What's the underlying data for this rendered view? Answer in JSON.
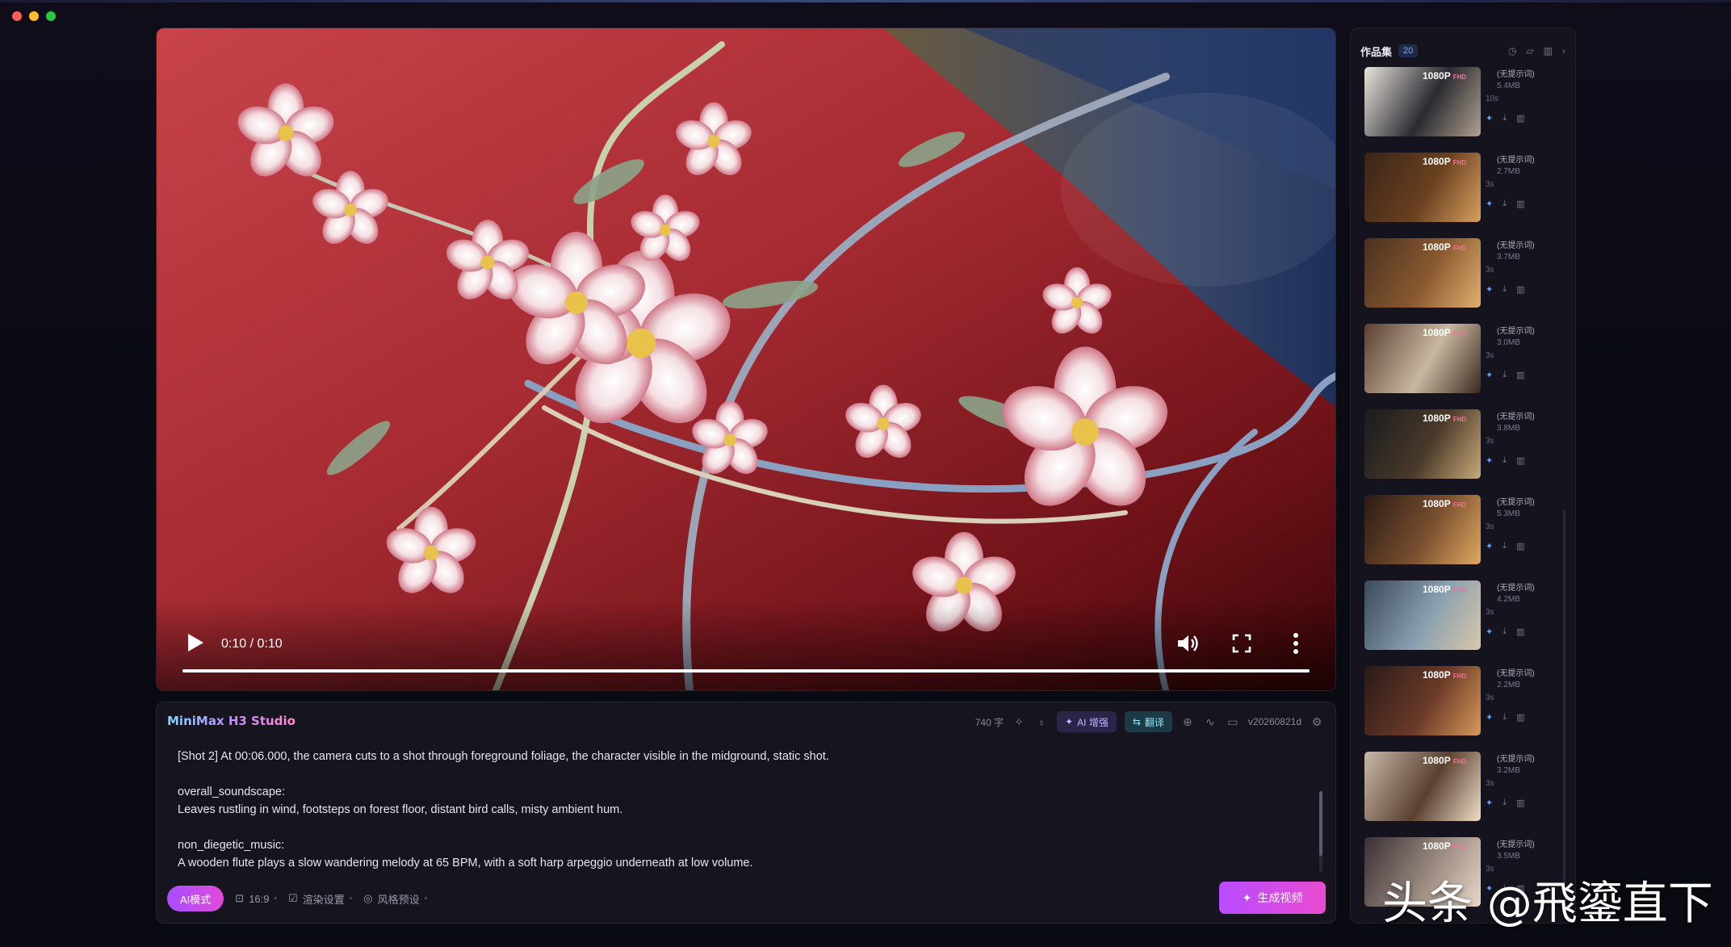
{
  "video": {
    "time": "0:10 / 0:10",
    "progress_fraction": 1.0
  },
  "prompt": {
    "brand": "MiniMax H3 Studio",
    "char_count": "740 字",
    "ai_enhance": "AI 增强",
    "translate": "翻译",
    "version": "v20260821d",
    "text": "[Shot 2] At 00:06.000, the camera cuts to a shot through foreground foliage, the character visible in the midground, static shot.\n\noverall_soundscape:\nLeaves rustling in wind, footsteps on forest floor, distant bird calls, misty ambient hum.\n\nnon_diegetic_music:\nA wooden flute plays a slow wandering melody at 65 BPM, with a soft harp arpeggio underneath at low volume.",
    "ai_mode": "AI模式",
    "ratio": "16:9",
    "render_settings": "渲染设置",
    "style_preset": "风格预设",
    "generate": "生成视频"
  },
  "gallery": {
    "title": "作品集",
    "count": "20",
    "items": [
      {
        "res": "1080P",
        "fhd": "FHD",
        "label": "(无提示词)",
        "size": "5.4MB",
        "duration": "10s"
      },
      {
        "res": "1080P",
        "fhd": "FHD",
        "label": "(无提示词)",
        "size": "2.7MB",
        "duration": "3s"
      },
      {
        "res": "1080P",
        "fhd": "FHD",
        "label": "(无提示词)",
        "size": "3.7MB",
        "duration": "3s"
      },
      {
        "res": "1080P",
        "fhd": "FHD",
        "label": "(无提示词)",
        "size": "3.0MB",
        "duration": "3s"
      },
      {
        "res": "1080P",
        "fhd": "FHD",
        "label": "(无提示词)",
        "size": "3.8MB",
        "duration": "3s"
      },
      {
        "res": "1080P",
        "fhd": "FHD",
        "label": "(无提示词)",
        "size": "5.3MB",
        "duration": "3s"
      },
      {
        "res": "1080P",
        "fhd": "FHD",
        "label": "(无提示词)",
        "size": "4.2MB",
        "duration": "3s"
      },
      {
        "res": "1080P",
        "fhd": "FHD",
        "label": "(无提示词)",
        "size": "2.2MB",
        "duration": "3s"
      },
      {
        "res": "1080P",
        "fhd": "FHD",
        "label": "(无提示词)",
        "size": "3.2MB",
        "duration": "3s"
      },
      {
        "res": "1080P",
        "fhd": "FHD",
        "label": "(无提示词)",
        "size": "3.5MB",
        "duration": "3s"
      }
    ]
  },
  "watermark": "头条 @飛鎏直下",
  "colors": {
    "accent": "#c04cff",
    "accent2": "#e94bd0"
  }
}
